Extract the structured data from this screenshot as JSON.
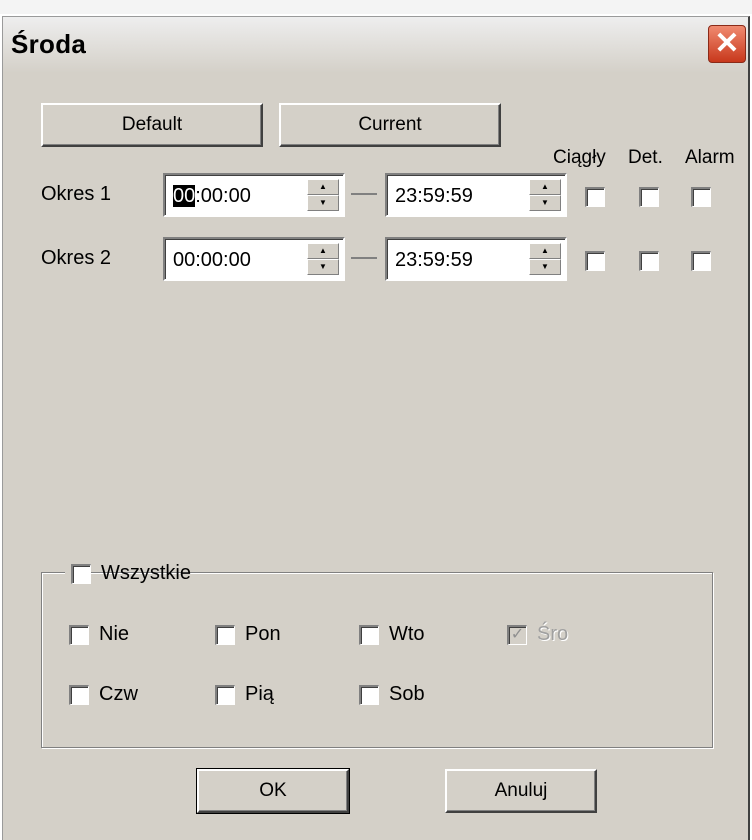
{
  "window": {
    "title": "Środa",
    "close_glyph": "✕",
    "close_icon": "close-icon"
  },
  "buttons": {
    "default": "Default",
    "current": "Current",
    "ok": "OK",
    "cancel": "Anuluj"
  },
  "columns": {
    "continuous": "Ciągły",
    "detection": "Det.",
    "alarm": "Alarm"
  },
  "periods": [
    {
      "label": "Okres 1",
      "start_selected": "00",
      "start_rest": ":00:00",
      "end": "23:59:59",
      "continuous": false,
      "detection": false,
      "alarm": false
    },
    {
      "label": "Okres 2",
      "start_selected": "",
      "start_rest": "00:00:00",
      "end": "23:59:59",
      "continuous": false,
      "detection": false,
      "alarm": false
    }
  ],
  "days_group": {
    "all_label": "Wszystkie",
    "all_checked": false,
    "days": [
      {
        "label": "Nie",
        "checked": false,
        "disabled": false
      },
      {
        "label": "Pon",
        "checked": false,
        "disabled": false
      },
      {
        "label": "Wto",
        "checked": false,
        "disabled": false
      },
      {
        "label": "Śro",
        "checked": true,
        "disabled": true
      },
      {
        "label": "Czw",
        "checked": false,
        "disabled": false
      },
      {
        "label": "Pią",
        "checked": false,
        "disabled": false
      },
      {
        "label": "Sob",
        "checked": false,
        "disabled": false
      }
    ]
  },
  "colors": {
    "dialog_bg": "#d4d0c8",
    "close_button": "#d9492a"
  }
}
